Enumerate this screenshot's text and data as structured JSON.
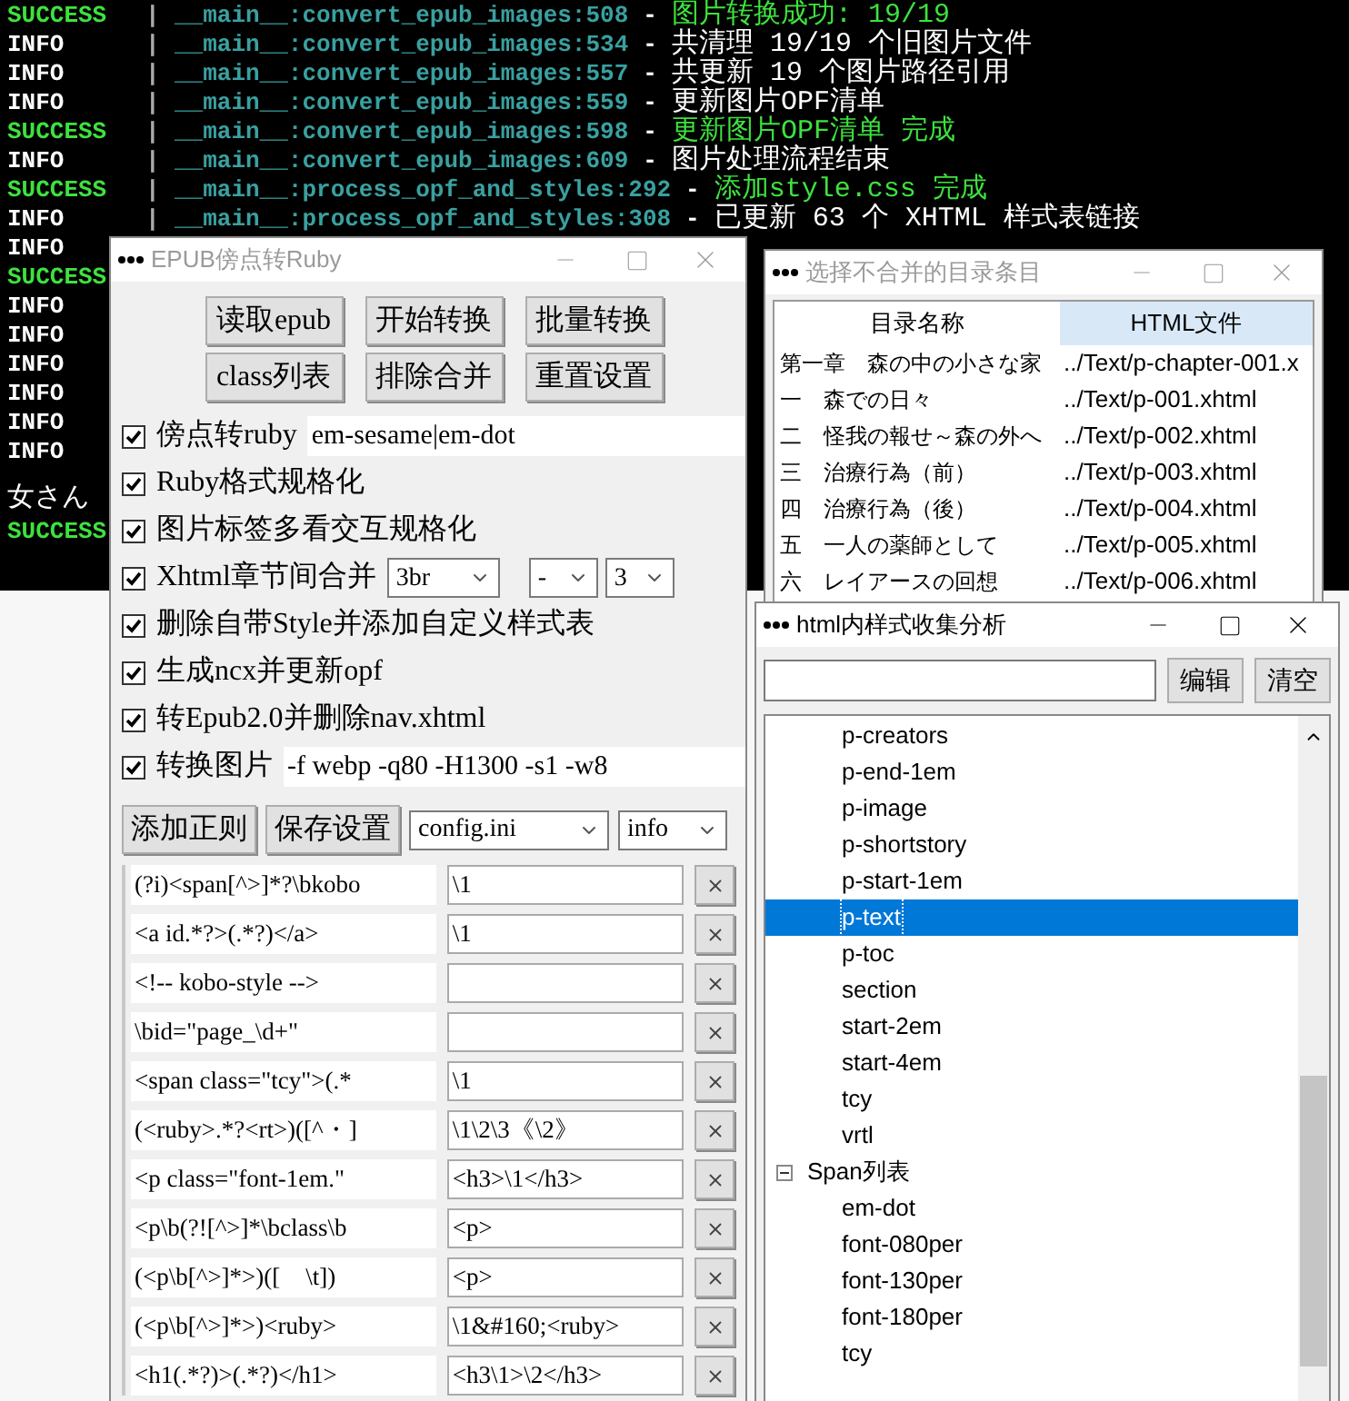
{
  "terminal": {
    "lines": [
      {
        "level": "SUCCESS",
        "sep": "|",
        "source": "__main__:convert_epub_images:508",
        "dash": "-",
        "message": "图片转换成功: 19/19"
      },
      {
        "level": "INFO",
        "sep": "|",
        "source": "__main__:convert_epub_images:534",
        "dash": "-",
        "message": "共清理 19/19 个旧图片文件"
      },
      {
        "level": "INFO",
        "sep": "|",
        "source": "__main__:convert_epub_images:557",
        "dash": "-",
        "message": "共更新 19 个图片路径引用"
      },
      {
        "level": "INFO",
        "sep": "|",
        "source": "__main__:convert_epub_images:559",
        "dash": "-",
        "message": "更新图片OPF清单"
      },
      {
        "level": "SUCCESS",
        "sep": "|",
        "source": "__main__:convert_epub_images:598",
        "dash": "-",
        "message": "更新图片OPF清单 完成"
      },
      {
        "level": "INFO",
        "sep": "|",
        "source": "__main__:convert_epub_images:609",
        "dash": "-",
        "message": "图片处理流程结束"
      },
      {
        "level": "SUCCESS",
        "sep": "|",
        "source": "__main__:process_opf_and_styles:292",
        "dash": "-",
        "message": "添加style.css 完成"
      },
      {
        "level": "INFO",
        "sep": "|",
        "source": "__main__:process_opf_and_styles:308",
        "dash": "-",
        "message": "已更新 63 个 XHTML 样式表链接"
      },
      {
        "level": "INFO"
      },
      {
        "level": "SUCCESS"
      },
      {
        "level": "INFO"
      },
      {
        "level": "INFO"
      },
      {
        "level": "INFO"
      },
      {
        "level": "INFO"
      },
      {
        "level": "INFO"
      },
      {
        "level": "INFO"
      },
      {
        "level": "女さん"
      },
      {
        "level": "SUCCESS"
      }
    ]
  },
  "main_window": {
    "title": "EPUB傍点转Ruby",
    "active": false,
    "buttons": [
      [
        "读取epub",
        "开始转换",
        "批量转换"
      ],
      [
        "class列表",
        "排除合并",
        "重置设置"
      ]
    ],
    "options": [
      {
        "kind": "input",
        "label": "傍点转ruby",
        "checked": true,
        "value": "em-sesame|em-dot"
      },
      {
        "kind": "plain",
        "label": "Ruby格式规格化",
        "checked": true
      },
      {
        "kind": "plain",
        "label": "图片标签多看交互规格化",
        "checked": true
      },
      {
        "kind": "selects",
        "label": "Xhtml章节间合并",
        "checked": true,
        "selects": [
          "3br",
          "-",
          "3"
        ]
      },
      {
        "kind": "plain",
        "label": "删除自带Style并添加自定义样式表",
        "checked": true
      },
      {
        "kind": "plain",
        "label": "生成ncx并更新opf",
        "checked": true
      },
      {
        "kind": "plain",
        "label": "转Epub2.0并删除nav.xhtml",
        "checked": true
      },
      {
        "kind": "input",
        "label": "转换图片",
        "checked": true,
        "value": "-f webp -q80 -H1300 -s1 -w8"
      }
    ],
    "toolbar": {
      "buttons": [
        "添加正则",
        "保存设置"
      ],
      "config_select": "config.ini",
      "log_select": "info"
    },
    "regex_rules": [
      {
        "pattern": "(?i)<span[^>]*?\\bkobo",
        "replacement": "\\1"
      },
      {
        "pattern": "<a id.*?>(.*?)</a>",
        "replacement": "\\1"
      },
      {
        "pattern": "<!-- kobo-style -->"
      },
      {
        "pattern": "\\bid=\"page_\\d+\""
      },
      {
        "pattern": "<span class=\"tcy\">(.*",
        "replacement": "\\1"
      },
      {
        "pattern": "(<ruby>.*?<rt>)([^・]",
        "replacement": "\\1\\2\\3《\\2》"
      },
      {
        "pattern": "<p class=\"font-1em.\"",
        "replacement": "<h3>\\1</h3>"
      },
      {
        "pattern": "<p\\b(?![^>]*\\bclass\\b",
        "replacement": "<p>"
      },
      {
        "pattern": "(<p\\b[^>]*>)([　\\t])",
        "replacement": "<p>"
      },
      {
        "pattern": "(<p\\b[^>]*>)<ruby>",
        "replacement": "\\1&#160;<ruby>"
      },
      {
        "pattern": "<h1(.*?)>(.*?)</h1>",
        "replacement": "<h3\\1>\\2</h3>"
      }
    ]
  },
  "toc_window": {
    "title": "选择不合并的目录条目",
    "active": false,
    "columns": [
      {
        "label": "目录名称",
        "highlighted": false
      },
      {
        "label": "HTML文件",
        "highlighted": true
      }
    ],
    "rows": [
      {
        "name": "第一章　森の中の小さな家",
        "file": "../Text/p-chapter-001.x"
      },
      {
        "name": "一　森での日々",
        "file": "../Text/p-001.xhtml"
      },
      {
        "name": "二　怪我の報せ～森の外へ",
        "file": "../Text/p-002.xhtml"
      },
      {
        "name": "三　治療行為（前）",
        "file": "../Text/p-003.xhtml"
      },
      {
        "name": "四　治療行為（後）",
        "file": "../Text/p-004.xhtml"
      },
      {
        "name": "五　一人の薬師として",
        "file": "../Text/p-005.xhtml"
      },
      {
        "name": "六　レイアースの回想",
        "file": "../Text/p-006.xhtml"
      }
    ]
  },
  "style_window": {
    "title": "html内样式收集分析",
    "active": true,
    "buttons": [
      "编辑",
      "清空"
    ],
    "tree": [
      {
        "children": [
          {
            "label": "p-creators",
            "selected": false
          },
          {
            "label": "p-end-1em",
            "selected": false
          },
          {
            "label": "p-image",
            "selected": false
          },
          {
            "label": "p-shortstory",
            "selected": false
          },
          {
            "label": "p-start-1em",
            "selected": false
          },
          {
            "label": "p-text",
            "selected": true
          },
          {
            "label": "p-toc",
            "selected": false
          },
          {
            "label": "section",
            "selected": false
          },
          {
            "label": "start-2em",
            "selected": false
          },
          {
            "label": "start-4em",
            "selected": false
          },
          {
            "label": "tcy",
            "selected": false
          },
          {
            "label": "vrtl",
            "selected": false
          }
        ]
      },
      {
        "label": "Span列表",
        "expanded": true,
        "selected": false,
        "children": [
          {
            "label": "em-dot",
            "selected": false
          },
          {
            "label": "font-080per",
            "selected": false
          },
          {
            "label": "font-130per",
            "selected": false
          },
          {
            "label": "font-180per",
            "selected": false
          },
          {
            "label": "tcy",
            "selected": false
          }
        ]
      }
    ]
  }
}
